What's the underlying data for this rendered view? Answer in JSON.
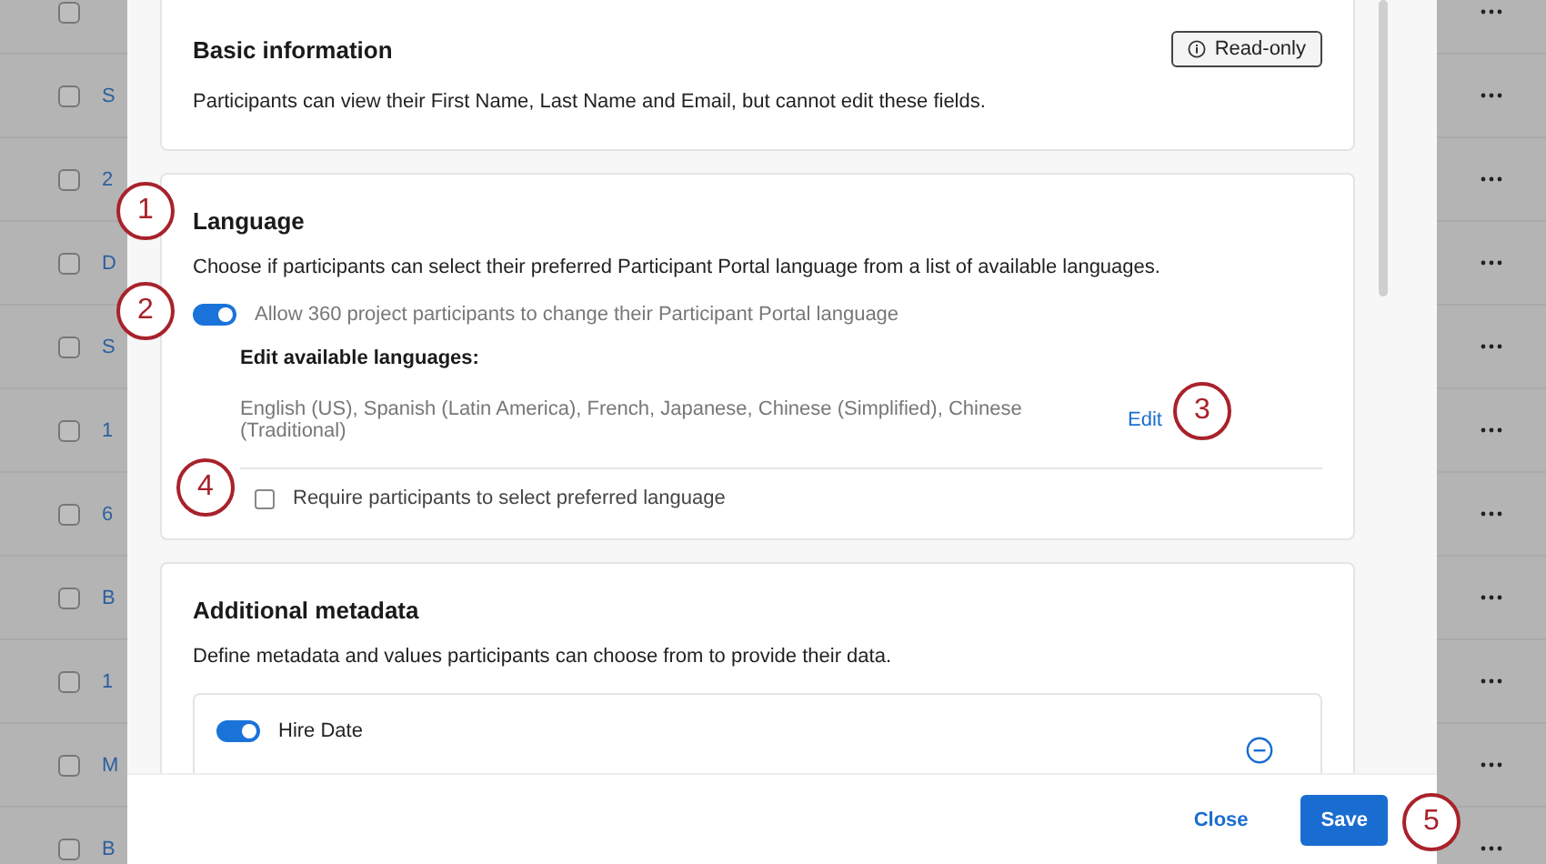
{
  "background_rows": [
    {
      "checked": false
    },
    {
      "link": "S",
      "checked": false
    },
    {
      "link": "2",
      "checked": false
    },
    {
      "link": "D",
      "checked": false
    },
    {
      "link": "S",
      "checked": false
    },
    {
      "link": "1",
      "checked": false
    },
    {
      "link": "6",
      "checked": false
    },
    {
      "link": "B",
      "checked": false
    },
    {
      "link": "1",
      "checked": false
    },
    {
      "link": "M",
      "checked": false
    },
    {
      "link": "B",
      "checked": false
    }
  ],
  "modal": {
    "basic_info": {
      "title": "Basic information",
      "description": "Participants can view their First Name, Last Name and Email, but cannot edit these fields.",
      "badge": "Read-only"
    },
    "language": {
      "title": "Language",
      "description": "Choose if participants can select their preferred Participant Portal language from a list of available languages.",
      "allow_toggle": {
        "label": "Allow 360 project participants to change their Participant Portal language",
        "on": true
      },
      "edit_heading": "Edit available languages:",
      "languages": "English (US), Spanish (Latin America), French, Japanese, Chinese (Simplified), Chinese (Traditional)",
      "edit_link": "Edit",
      "require_checkbox": {
        "label": "Require participants to select preferred language",
        "checked": false
      }
    },
    "metadata": {
      "title": "Additional metadata",
      "description": "Define metadata and values participants can choose from to provide their data.",
      "items": [
        {
          "label": "Hire Date",
          "on": true
        }
      ]
    }
  },
  "footer": {
    "buttons": [
      {
        "label": "Close",
        "kind": "secondary"
      },
      {
        "label": "Save",
        "kind": "primary"
      }
    ]
  },
  "callouts": [
    "1",
    "2",
    "3",
    "4",
    "5"
  ]
}
